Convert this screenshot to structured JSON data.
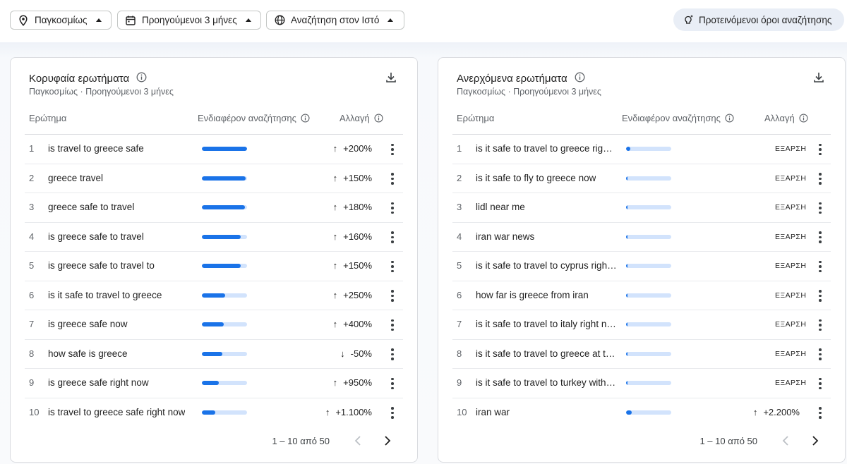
{
  "filters": {
    "location": "Παγκοσμίως",
    "time": "Προηγούμενοι 3 μήνες",
    "search_type": "Αναζήτηση στον Ιστό",
    "suggested": "Προτεινόμενοι όροι αναζήτησης"
  },
  "icons": [
    "location-pin-icon",
    "calendar-icon",
    "globe-icon",
    "sparkle-bulb-icon",
    "info-icon",
    "download-icon",
    "more-vert-icon",
    "chevron-left-icon",
    "chevron-right-icon"
  ],
  "colors": {
    "bar_fill": "#1a73e8",
    "bar_track": "#d2e3fc",
    "chip_suggest_bg": "#e9eef6"
  },
  "left": {
    "title": "Κορυφαία ερωτήματα",
    "subtitle": "Παγκοσμίως · Προηγούμενοι 3 μήνες",
    "headers": {
      "query": "Ερώτημα",
      "interest": "Ενδιαφέρον αναζήτησης",
      "change": "Αλλαγή"
    },
    "rows": [
      {
        "rank": "1",
        "query": "is travel to greece safe",
        "interest": 1.0,
        "direction": "up",
        "change": "+200%"
      },
      {
        "rank": "2",
        "query": "greece travel",
        "interest": 0.97,
        "direction": "up",
        "change": "+150%"
      },
      {
        "rank": "3",
        "query": "greece safe to travel",
        "interest": 0.95,
        "direction": "up",
        "change": "+180%"
      },
      {
        "rank": "4",
        "query": "is greece safe to travel",
        "interest": 0.86,
        "direction": "up",
        "change": "+160%"
      },
      {
        "rank": "5",
        "query": "is greece safe to travel to",
        "interest": 0.86,
        "direction": "up",
        "change": "+150%"
      },
      {
        "rank": "6",
        "query": "is it safe to travel to greece",
        "interest": 0.52,
        "direction": "up",
        "change": "+250%"
      },
      {
        "rank": "7",
        "query": "is greece safe now",
        "interest": 0.48,
        "direction": "up",
        "change": "+400%"
      },
      {
        "rank": "8",
        "query": "how safe is greece",
        "interest": 0.45,
        "direction": "down",
        "change": "-50%"
      },
      {
        "rank": "9",
        "query": "is greece safe right now",
        "interest": 0.38,
        "direction": "up",
        "change": "+950%"
      },
      {
        "rank": "10",
        "query": "is travel to greece safe right now",
        "interest": 0.3,
        "direction": "up",
        "change": "+1.100%"
      }
    ],
    "pager": "1 – 10 από 50"
  },
  "right": {
    "title": "Ανερχόμενα ερωτήματα",
    "subtitle": "Παγκοσμίως · Προηγούμενοι 3 μήνες",
    "headers": {
      "query": "Ερώτημα",
      "interest": "Ενδιαφέρον αναζήτησης",
      "change": "Αλλαγή"
    },
    "rows": [
      {
        "rank": "1",
        "query": "is it safe to travel to greece righ…",
        "interest": 0.1,
        "direction": "",
        "change": "ΕΞΑΡΣΗ"
      },
      {
        "rank": "2",
        "query": "is it safe to fly to greece now",
        "interest": 0.03,
        "direction": "",
        "change": "ΕΞΑΡΣΗ"
      },
      {
        "rank": "3",
        "query": "lidl near me",
        "interest": 0.03,
        "direction": "",
        "change": "ΕΞΑΡΣΗ"
      },
      {
        "rank": "4",
        "query": "iran war news",
        "interest": 0.03,
        "direction": "",
        "change": "ΕΞΑΡΣΗ"
      },
      {
        "rank": "5",
        "query": "is it safe to travel to cyprus righ…",
        "interest": 0.03,
        "direction": "",
        "change": "ΕΞΑΡΣΗ"
      },
      {
        "rank": "6",
        "query": "how far is greece from iran",
        "interest": 0.03,
        "direction": "",
        "change": "ΕΞΑΡΣΗ"
      },
      {
        "rank": "7",
        "query": "is it safe to travel to italy right n…",
        "interest": 0.03,
        "direction": "",
        "change": "ΕΞΑΡΣΗ"
      },
      {
        "rank": "8",
        "query": "is it safe to travel to greece at t…",
        "interest": 0.03,
        "direction": "",
        "change": "ΕΞΑΡΣΗ"
      },
      {
        "rank": "9",
        "query": "is it safe to travel to turkey with…",
        "interest": 0.03,
        "direction": "",
        "change": "ΕΞΑΡΣΗ"
      },
      {
        "rank": "10",
        "query": "iran war",
        "interest": 0.12,
        "direction": "up",
        "change": "+2.200%"
      }
    ],
    "pager": "1 – 10 από 50"
  }
}
